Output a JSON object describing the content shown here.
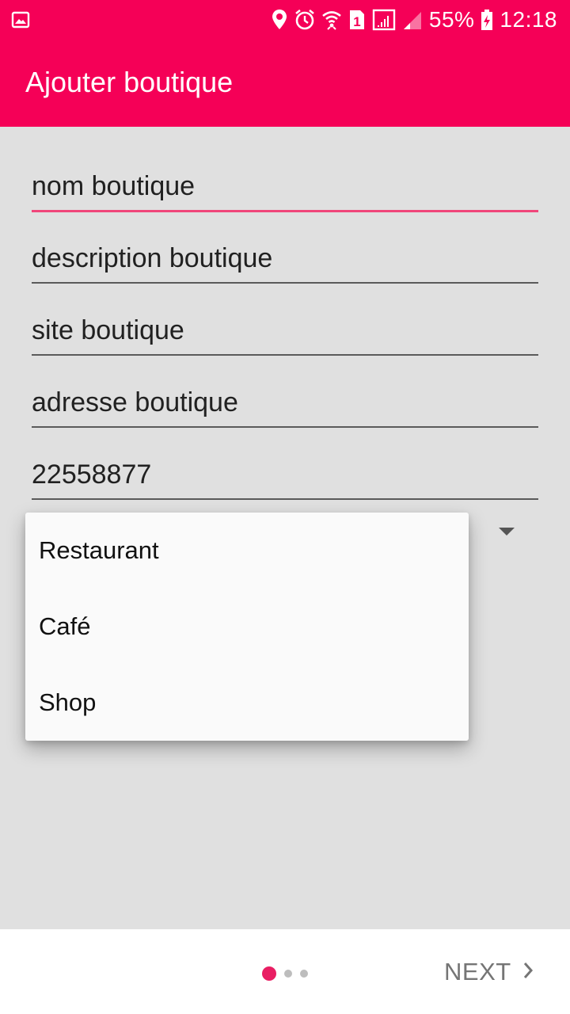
{
  "status_bar": {
    "battery": "55%",
    "time": "12:18",
    "sim_slot": "1",
    "icons": [
      "gallery-icon",
      "location-icon",
      "alarm-icon",
      "wifi-icon",
      "sim-icon",
      "signal-icon",
      "signal-weak-icon",
      "battery-charging-icon"
    ]
  },
  "app_bar": {
    "title": "Ajouter boutique"
  },
  "form": {
    "name": "nom boutique",
    "description": "description boutique",
    "site": "site boutique",
    "address": "adresse boutique",
    "phone": "22558877"
  },
  "dropdown": {
    "options": [
      "Restaurant",
      "Café",
      "Shop"
    ]
  },
  "bottom_bar": {
    "next_label": "NEXT",
    "page_indicator": {
      "current": 1,
      "total": 3
    }
  },
  "colors": {
    "primary": "#f50057",
    "accent": "#e91e63",
    "background": "#e0e0e0"
  }
}
